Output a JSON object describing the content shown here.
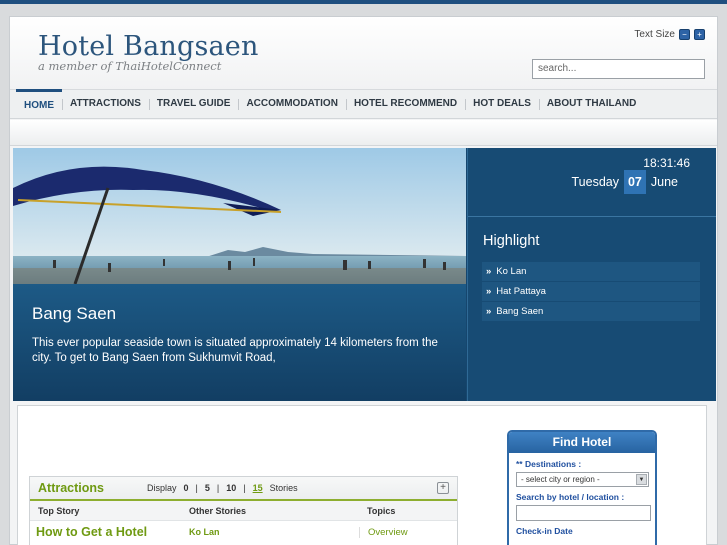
{
  "header": {
    "title": "Hotel Bangsaen",
    "subtitle": "a member of ThaiHotelConnect",
    "text_size_label": "Text Size",
    "search_placeholder": "search..."
  },
  "nav": {
    "items": [
      {
        "label": "HOME",
        "active": true
      },
      {
        "label": "ATTRACTIONS"
      },
      {
        "label": "TRAVEL GUIDE"
      },
      {
        "label": "ACCOMMODATION"
      },
      {
        "label": "HOTEL RECOMMEND"
      },
      {
        "label": "HOT DEALS"
      },
      {
        "label": "ABOUT THAILAND"
      }
    ]
  },
  "banner": {
    "place_title": "Bang Saen",
    "place_text": "This ever popular seaside town is situated approximately 14 kilometers from the city. To get to Bang Saen from Sukhumvit Road,",
    "time": "18:31:46",
    "weekday": "Tuesday",
    "day": "07",
    "month": "June",
    "highlight_title": "Highlight",
    "highlights": [
      "Ko Lan",
      "Hat Pattaya",
      "Bang Saen"
    ]
  },
  "attractions": {
    "title": "Attractions",
    "display_label": "Display",
    "counts": [
      "0",
      "5",
      "10",
      "15"
    ],
    "selected_count": "15",
    "stories_label": "Stories",
    "columns": [
      "Top Story",
      "Other Stories",
      "Topics"
    ],
    "row": {
      "top": "How to Get a Hotel",
      "other": "Ko Lan",
      "topic": "Overview"
    }
  },
  "find_hotel": {
    "title": "Find Hotel",
    "destinations_label": "** Destinations :",
    "destination_select": "- select city or region -",
    "search_label": "Search by hotel / location :",
    "checkin_label": "Check-in Date"
  },
  "colors": {
    "brand_blue": "#1f4f7f",
    "accent_green": "#6f9a12",
    "panel_blue": "#174b74"
  }
}
